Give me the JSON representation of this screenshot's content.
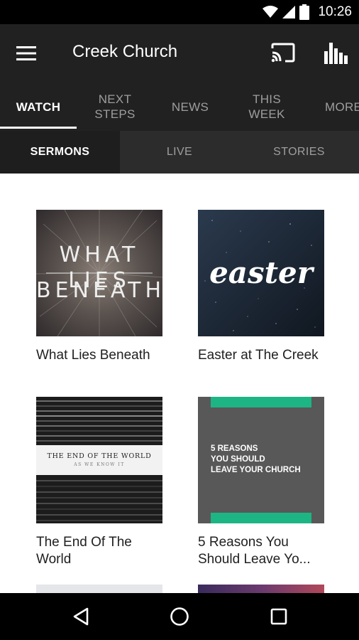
{
  "status_bar": {
    "time": "10:26"
  },
  "app_bar": {
    "title": "Creek Church",
    "icons": {
      "menu": "hamburger-menu-icon",
      "cast": "cast-icon",
      "stats": "bar-chart-icon"
    }
  },
  "tabs": [
    {
      "label": "WATCH",
      "active": true
    },
    {
      "label": "NEXT STEPS",
      "active": false
    },
    {
      "label": "NEWS",
      "active": false
    },
    {
      "label": "THIS WEEK",
      "active": false
    },
    {
      "label": "MORE",
      "active": false
    }
  ],
  "subtabs": [
    {
      "label": "SERMONS",
      "active": true
    },
    {
      "label": "LIVE",
      "active": false
    },
    {
      "label": "STORIES",
      "active": false
    }
  ],
  "sermons": [
    {
      "title": "What Lies Beneath",
      "art_text": [
        "WHAT LIES",
        "BENEATH"
      ]
    },
    {
      "title": "Easter at The Creek",
      "art_text": [
        "easter"
      ]
    },
    {
      "title": "The End Of The World",
      "art_text": [
        "THE END OF THE WORLD",
        "AS WE KNOW IT"
      ]
    },
    {
      "title": "5 Reasons You Should Leave Yo...",
      "art_text": [
        "5 REASONS",
        "YOU SHOULD",
        "LEAVE YOUR CHURCH"
      ]
    }
  ],
  "colors": {
    "app_bar": "#212121",
    "subtab_bar": "#2c2c2c",
    "green_accent": "#1db584",
    "gray_card": "#585858"
  },
  "nav_bar": {
    "icons": [
      "back-icon",
      "home-icon",
      "recents-icon"
    ]
  }
}
